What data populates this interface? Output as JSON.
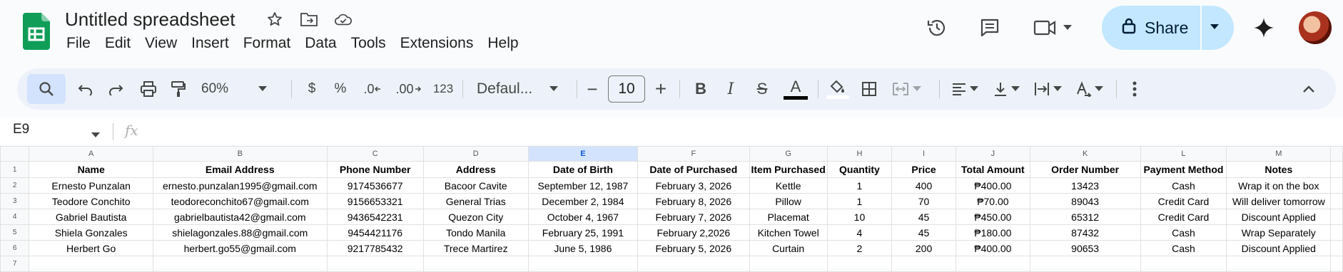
{
  "doc": {
    "title": "Untitled spreadsheet"
  },
  "menu": [
    "File",
    "Edit",
    "View",
    "Insert",
    "Format",
    "Data",
    "Tools",
    "Extensions",
    "Help"
  ],
  "share": {
    "label": "Share"
  },
  "toolbar": {
    "zoom": "60%",
    "currency": "$",
    "percent": "%",
    "dec_decrease": ".0",
    "dec_increase": ".00",
    "number_format": "123",
    "font": "Defaul...",
    "font_size": "10",
    "minus": "−",
    "plus": "+",
    "bold": "B",
    "italic": "I",
    "strike": "S",
    "text_color": "A",
    "text_color_value": "#000000"
  },
  "formula_bar": {
    "cell_ref": "E9",
    "fx": "fx",
    "value": ""
  },
  "sheet": {
    "columns": [
      "A",
      "B",
      "C",
      "D",
      "E",
      "F",
      "G",
      "H",
      "I",
      "J",
      "K",
      "L",
      "M"
    ],
    "selected_column": "E",
    "headers": [
      "Name",
      "Email Address",
      "Phone Number",
      "Address",
      "Date of Birth",
      "Date of Purchased",
      "Item Purchased",
      "Quantity",
      "Price",
      "Total Amount",
      "Order Number",
      "Payment Method",
      "Notes"
    ],
    "rows": [
      [
        "Ernesto Punzalan",
        "ernesto.punzalan1995@gmail.com",
        "9174536677",
        "Bacoor Cavite",
        "September 12, 1987",
        "February 3, 2026",
        "Kettle",
        "1",
        "400",
        "₱400.00",
        "13423",
        "Cash",
        "Wrap it on the box"
      ],
      [
        "Teodore Conchito",
        "teodoreconchito67@gmail.com",
        "9156653321",
        "General Trias",
        "December 2, 1984",
        "February 8, 2026",
        "Pillow",
        "1",
        "70",
        "₱70.00",
        "89043",
        "Credit Card",
        "Will deliver tomorrow"
      ],
      [
        "Gabriel Bautista",
        "gabrielbautista42@gmail.com",
        "9436542231",
        "Quezon City",
        "October 4, 1967",
        "February 7, 2026",
        "Placemat",
        "10",
        "45",
        "₱450.00",
        "65312",
        "Credit Card",
        "Discount Applied"
      ],
      [
        "Shiela Gonzales",
        "shielagonzales.88@gmail.com",
        "9454421176",
        "Tondo Manila",
        "February 25, 1991",
        "February 2,2026",
        "Kitchen Towel",
        "4",
        "45",
        "₱180.00",
        "87432",
        "Cash",
        "Wrap Separately"
      ],
      [
        "Herbert Go",
        "herbert.go55@gmail.com",
        "9217785432",
        "Trece Martirez",
        "June 5, 1986",
        "February 5, 2026",
        "Curtain",
        "2",
        "200",
        "₱400.00",
        "90653",
        "Cash",
        "Discount Applied"
      ]
    ],
    "row_numbers": [
      "1",
      "2",
      "3",
      "4",
      "5",
      "6",
      "7"
    ]
  }
}
